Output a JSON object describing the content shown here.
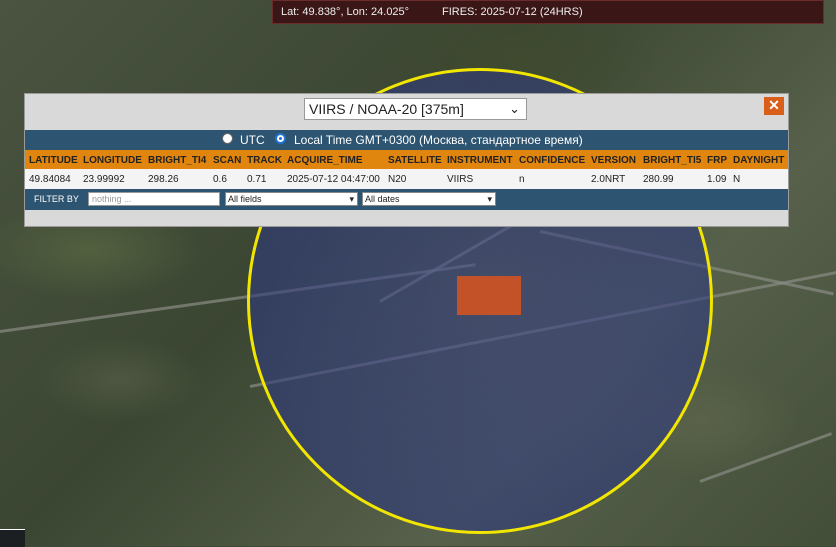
{
  "status_bar": {
    "coords": "Lat: 49.838°, Lon: 24.025°",
    "fires": "FIRES: 2025-07-12 (24HRS)"
  },
  "popup": {
    "sensor_select": "VIIRS / NOAA-20 [375m]",
    "close_label": "✕",
    "timezone": {
      "utc_label": "UTC",
      "local_label": "Local Time GMT+0300 (Москва, стандартное время)",
      "selected": "local"
    },
    "table": {
      "headers": [
        "LATITUDE",
        "LONGITUDE",
        "BRIGHT_TI4",
        "SCAN",
        "TRACK",
        "ACQUIRE_TIME",
        "SATELLITE",
        "INSTRUMENT",
        "CONFIDENCE",
        "VERSION",
        "BRIGHT_TI5",
        "FRP",
        "DAYNIGHT"
      ],
      "row": [
        "49.84084",
        "23.99992",
        "298.26",
        "0.6",
        "0.71",
        "2025-07-12 04:47:00",
        "N20",
        "VIIRS",
        "n",
        "2.0NRT",
        "280.99",
        "1.09",
        "N"
      ]
    },
    "filter": {
      "label": "FILTER BY",
      "placeholder": "nothing ...",
      "field_select": "All fields",
      "date_select": "All dates"
    }
  },
  "colors": {
    "circle": "#f2e600",
    "fire_marker": "#c35228",
    "header_row": "#e0860f",
    "bar_blue": "#2d5470",
    "close_button": "#d95e1a"
  }
}
